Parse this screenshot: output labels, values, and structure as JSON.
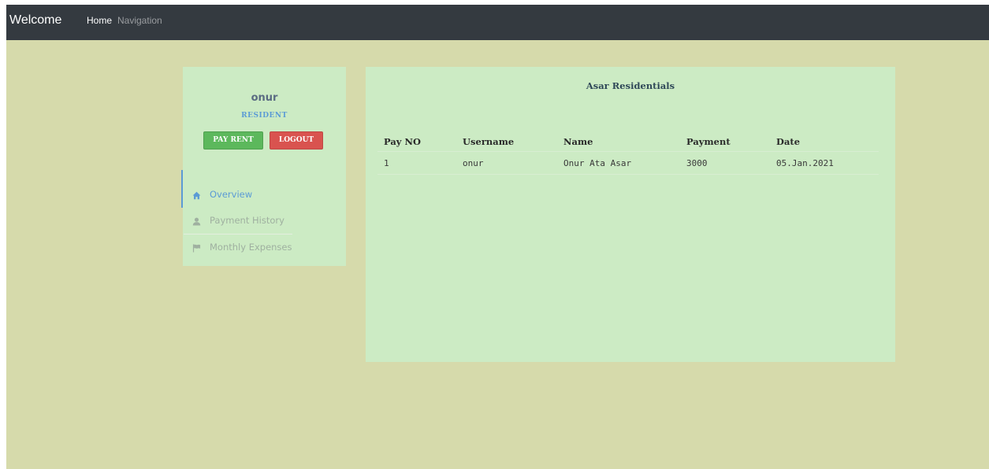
{
  "navbar": {
    "brand": "Welcome",
    "links": [
      {
        "label": "Home"
      },
      {
        "label": "Navigation"
      }
    ]
  },
  "profile": {
    "name": "onur",
    "role": "RESIDENT",
    "pay_rent_label": "PAY RENT",
    "logout_label": "LOGOUT"
  },
  "sidebar": {
    "items": [
      {
        "label": "Overview",
        "icon": "home-icon",
        "active": true
      },
      {
        "label": "Payment History",
        "icon": "user-icon",
        "active": false
      },
      {
        "label": "Monthly Expenses",
        "icon": "flag-icon",
        "active": false
      }
    ]
  },
  "panel": {
    "title": "Asar Residentials"
  },
  "table": {
    "headers": [
      "Pay NO",
      "Username",
      "Name",
      "Payment",
      "Date"
    ],
    "rows": [
      [
        "1",
        "onur",
        "Onur Ata Asar",
        "3000",
        "05.Jan.2021"
      ]
    ]
  },
  "colors": {
    "page_background": "#d6daab",
    "card_background": "#ccebc4",
    "navbar_background": "#343a40",
    "accent_blue": "#5b9bd5",
    "pay_button": "#5cb85c",
    "logout_button": "#d9534f"
  }
}
